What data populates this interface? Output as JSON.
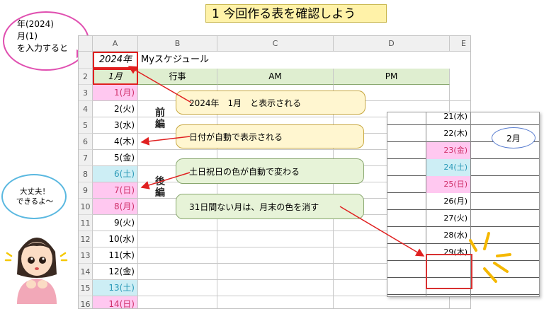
{
  "title": "1 今回作る表を確認しよう",
  "left_bubble": {
    "lines": [
      "年(2024)",
      "月(1)",
      "を入力すると"
    ]
  },
  "sheet": {
    "columns": [
      "A",
      "B",
      "C",
      "D",
      "E"
    ],
    "row_numbers": [
      "",
      "2",
      "3",
      "4",
      "5",
      "6",
      "7",
      "8",
      "9",
      "10",
      "11",
      "12",
      "13",
      "14",
      "15",
      "16"
    ],
    "year": "2024年",
    "caption": "Myスケジュール",
    "header_month": "1月",
    "header_cols": [
      "行事",
      "AM",
      "PM"
    ],
    "dates": [
      "1(月)",
      "2(火)",
      "3(水)",
      "4(木)",
      "5(金)",
      "6(土)",
      "7(日)",
      "8(月)",
      "9(火)",
      "10(水)",
      "11(木)",
      "12(金)",
      "13(土)",
      "14(日)"
    ],
    "date_kinds": [
      "holiday",
      "",
      "",
      "",
      "",
      "saturday",
      "holiday",
      "holiday",
      "",
      "",
      "",
      "",
      "saturday",
      "holiday"
    ],
    "labels": {
      "first_part": [
        "前",
        "編"
      ],
      "second_part": [
        "後",
        "編"
      ]
    }
  },
  "callouts": {
    "c1": "2024年　1月　と表示される",
    "c2": "日付が自動で表示される",
    "c3": "土日祝日の色が自動で変わる",
    "c4": "31日間ない月は、月末の色を消す"
  },
  "inset": {
    "dates": [
      "21(水)",
      "22(木)",
      "23(金)",
      "24(土)",
      "25(日)",
      "26(月)",
      "27(火)",
      "28(水)",
      "29(木)",
      "",
      "",
      ""
    ],
    "kinds": [
      "",
      "",
      "holiday",
      "saturday",
      "holiday",
      "",
      "",
      "",
      "",
      "",
      "",
      ""
    ],
    "month_label": "2月"
  },
  "right_bubble": {
    "lines": [
      "大丈夫！",
      "できるよ～"
    ]
  },
  "colors": {
    "holiday": "#ffc8f0",
    "saturday": "#cdeef5",
    "holiday_text": "#d0306a",
    "saturday_text": "#2b9ab8",
    "accent_red": "#e02020"
  }
}
